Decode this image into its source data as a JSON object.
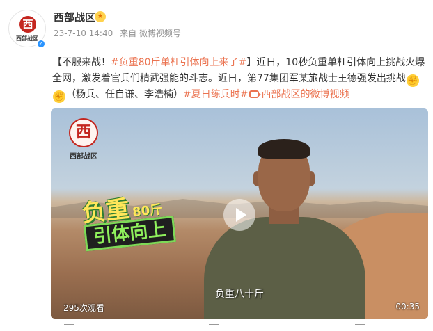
{
  "post": {
    "author": "西部战区",
    "avatar_text": "西",
    "avatar_caption": "西部战区",
    "verified_icon": "✓",
    "vip_icon": "★",
    "meta": {
      "time": "23-7-10 14:40",
      "source": "来自 微博视频号"
    },
    "text": {
      "part1": "【不服来战！",
      "topic1": "#负重80斤单杠引体向上来了#",
      "part2": "】近日，10秒负重单杠引体向上挑战火爆全网，激发着官兵们精武强能的斗志。近日，第77集团军某旅战士王德强发出挑战",
      "part3": "（杨兵、任自谦、李浩楠）",
      "topic2": "#夏日练兵时#",
      "link_label": "西部战区的微博视频"
    }
  },
  "video": {
    "watermark_char": "西",
    "watermark_caption": "西部战区",
    "overlay_line1": "负重",
    "overlay_line1_small": "80斤",
    "overlay_line2": "引体向上",
    "subtitle": "负重八十斤",
    "views": "295次观看",
    "duration": "00:35"
  },
  "colors": {
    "accent": "#eb7350",
    "verify_blue": "#2a94ff",
    "logo_red": "#c4261f"
  }
}
